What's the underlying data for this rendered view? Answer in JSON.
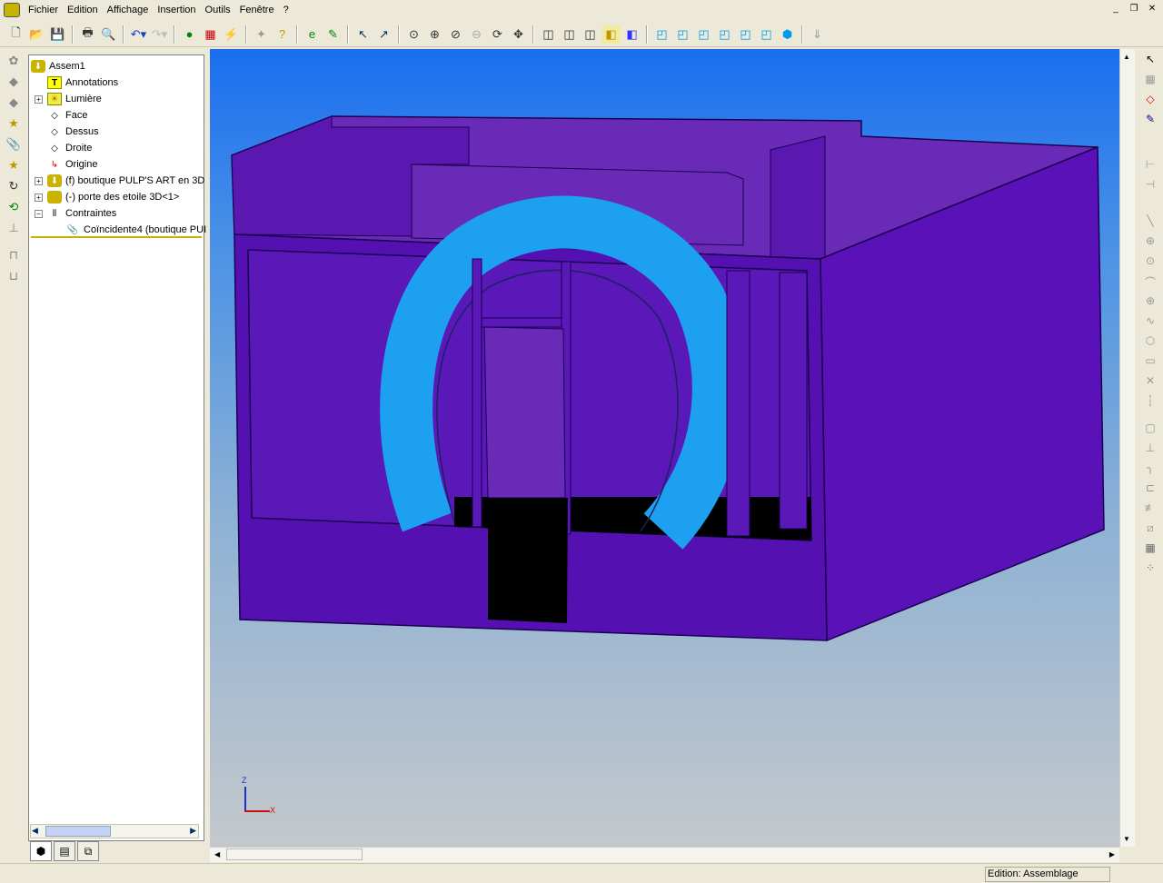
{
  "menu": {
    "items": [
      "Fichier",
      "Edition",
      "Affichage",
      "Insertion",
      "Outils",
      "Fenêtre",
      "?"
    ]
  },
  "tree": {
    "items": [
      {
        "label": "Assem1",
        "icon": "assembly-icon"
      },
      {
        "label": "Annotations",
        "icon": "annotations-icon"
      },
      {
        "label": "Lumière",
        "icon": "light-folder-icon",
        "expand": "+"
      },
      {
        "label": "Face",
        "icon": "plane-icon"
      },
      {
        "label": "Dessus",
        "icon": "plane-icon"
      },
      {
        "label": "Droite",
        "icon": "plane-icon"
      },
      {
        "label": "Origine",
        "icon": "origin-icon"
      },
      {
        "label": "(f) boutique PULP'S ART en 3D",
        "icon": "part-icon",
        "expand": "+"
      },
      {
        "label": "(-) porte des etoile 3D<1>",
        "icon": "part-icon",
        "expand": "+"
      },
      {
        "label": "Contraintes",
        "icon": "mates-icon",
        "expand": "−"
      },
      {
        "label": "Coïncidente4 (boutique PUI",
        "icon": "mate-icon"
      }
    ]
  },
  "status": {
    "mode": "Edition: Assemblage"
  },
  "triad": {
    "z": "Z",
    "x": "X"
  },
  "colors": {
    "model": "#5410b0",
    "side": "#5a12b8",
    "interior": "#6a2ab8",
    "stargate": "#1ea0f0",
    "opening": "#000000"
  }
}
